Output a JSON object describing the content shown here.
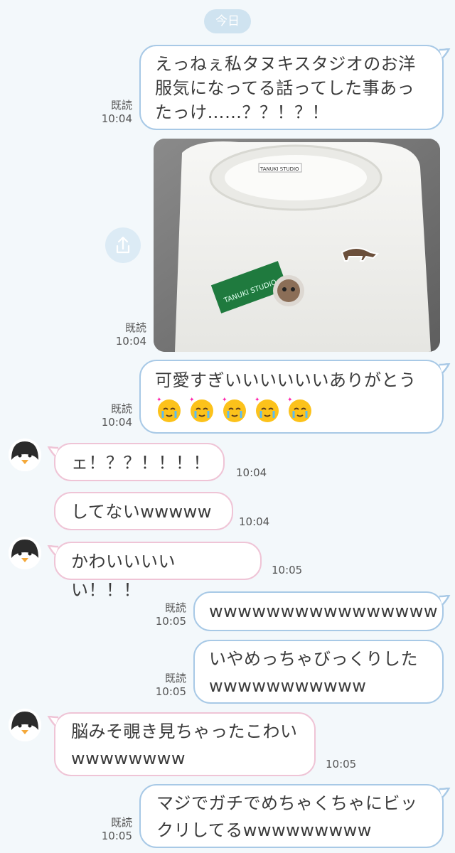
{
  "date_divider": "今日",
  "read_label": "既読",
  "messages": [
    {
      "text_lines": [
        "えっねぇ私タヌキスタジオのお洋",
        "服気になってる話ってした事あっ",
        "たっけ……？？！？！"
      ],
      "time": "10:04"
    },
    {
      "time": "10:04"
    },
    {
      "text_lines": [
        "可愛すぎいいいいいいありがとう"
      ],
      "time": "10:04"
    },
    {
      "text": "ェ！？？！！！！",
      "time": "10:04"
    },
    {
      "text": "してないwwwww",
      "time": "10:04"
    },
    {
      "text": "かわいいいいい！！！",
      "time": "10:05"
    },
    {
      "text": "wwwwwwwwwwwwwwww",
      "time": "10:05"
    },
    {
      "text_lines": [
        "いやめっちゃびっくりした",
        "wwwwwwwwwww"
      ],
      "time": "10:05"
    },
    {
      "text_lines": [
        "脳みそ覗き見ちゃったこわい",
        "wwwwwwww"
      ],
      "time": "10:05"
    },
    {
      "text_lines": [
        "マジでガチでめちゃくちゃにビッ",
        "クリしてるwwwwwwwww"
      ],
      "time": "10:05"
    }
  ],
  "photo": {
    "tag_label": "TANUKI STUDIO",
    "card_label": "TANUKI STUDIO"
  },
  "colors": {
    "outgoing_border": "#a8c9e6",
    "incoming_border": "#efc4d6",
    "background": "#f3f8fb"
  }
}
